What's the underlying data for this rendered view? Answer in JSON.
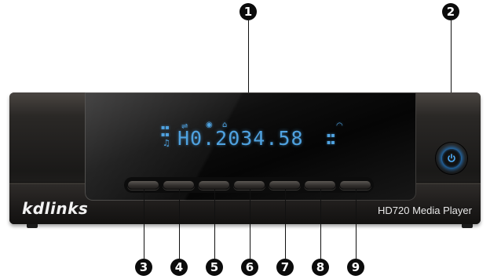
{
  "device": {
    "brand": "kdlinks",
    "model": "HD720 Media Player",
    "display_text": "H0.2034.58"
  },
  "callouts": {
    "top": [
      "1",
      "2"
    ],
    "bottom": [
      "3",
      "4",
      "5",
      "6",
      "7",
      "8",
      "9"
    ]
  },
  "colors": {
    "display": "#4fa2e0",
    "power_glow": "#1e8cf0",
    "body": "#1d1b1a"
  },
  "icons": {
    "power": "power-icon",
    "indicators": [
      "music-note-icon",
      "usb-icon",
      "lock-icon",
      "network-icon",
      "signal-icon"
    ]
  }
}
